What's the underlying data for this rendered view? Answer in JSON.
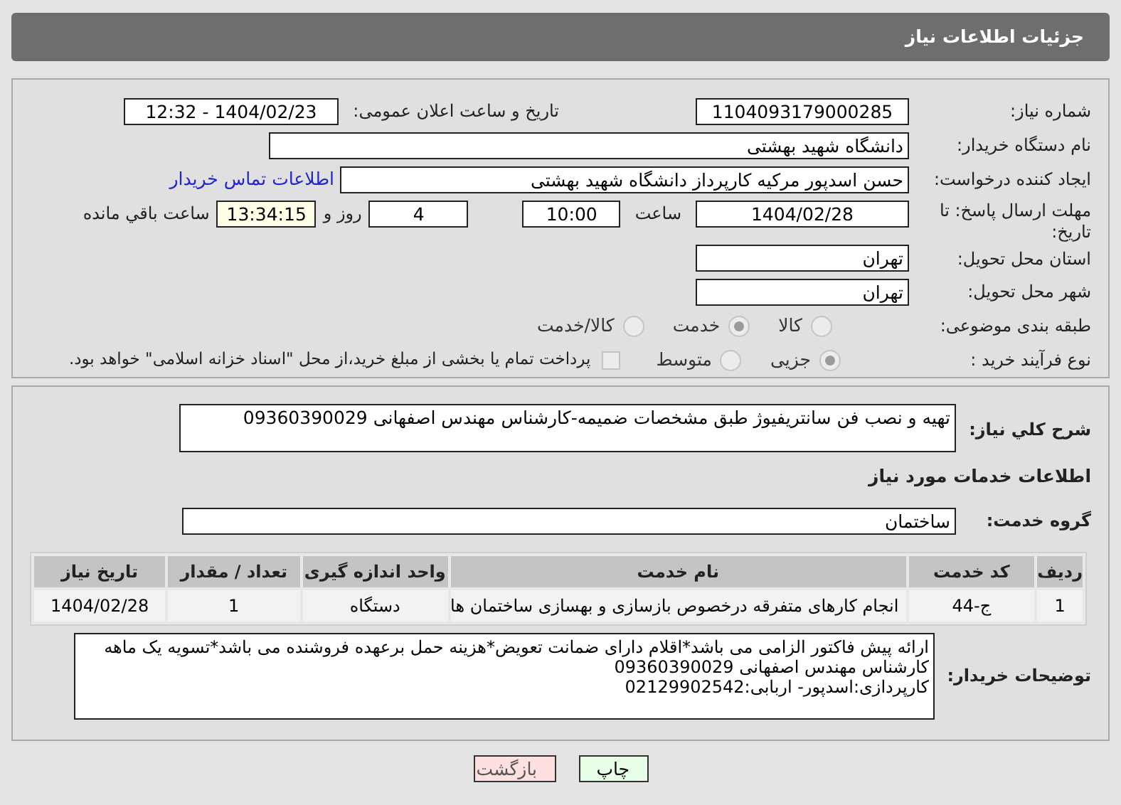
{
  "header": {
    "title": "جزئیات اطلاعات نیاز"
  },
  "details": {
    "need_number": {
      "label": "شماره نیاز:",
      "value": "1104093179000285"
    },
    "announce": {
      "label": "تاریخ و ساعت اعلان عمومی:",
      "value": "1404/02/23 - 12:32"
    },
    "buyer": {
      "label": "نام دستگاه خریدار:",
      "value": "دانشگاه شهید بهشتی"
    },
    "creator": {
      "label": "ایجاد کننده درخواست:",
      "value": "حسن اسدپور مرکیه کارپرداز دانشگاه شهید بهشتی",
      "link": "اطلاعات تماس خریدار"
    },
    "deadline": {
      "label": "مهلت ارسال پاسخ: تا تاریخ:",
      "date": "1404/02/28",
      "time_label": "ساعت",
      "time": "10:00",
      "days": "4",
      "days_label": "روز و",
      "remaining": "13:34:15",
      "remaining_label": "ساعت باقي مانده"
    },
    "province": {
      "label": "استان محل تحویل:",
      "value": "تهران"
    },
    "city": {
      "label": "شهر محل تحویل:",
      "value": "تهران"
    },
    "category": {
      "label": "طبقه بندی موضوعی:",
      "options": [
        {
          "label": "كالا",
          "selected": false
        },
        {
          "label": "خدمت",
          "selected": true
        },
        {
          "label": "كالا/خدمت",
          "selected": false
        }
      ]
    },
    "process": {
      "label": "نوع فرآیند خرید :",
      "options": [
        {
          "label": "جزیی",
          "selected": true
        },
        {
          "label": "متوسط",
          "selected": false
        }
      ],
      "treasury": {
        "checked": false,
        "label": "پرداخت تمام یا بخشی از مبلغ خرید،از محل \"اسناد خزانه اسلامی\" خواهد بود."
      }
    }
  },
  "services": {
    "summary": {
      "label": "شرح كلي نياز:",
      "value": "تهیه و نصب فن سانتریفیوژ طبق مشخصات ضمیمه-کارشناس مهندس اصفهانی 09360390029"
    },
    "heading": "اطلاعات خدمات مورد نياز",
    "group": {
      "label": "گروه خدمت:",
      "value": "ساختمان"
    },
    "table": {
      "columns": [
        "ردیف",
        "کد خدمت",
        "نام خدمت",
        "واحد اندازه گیری",
        "تعداد / مقدار",
        "تاریخ نیاز"
      ],
      "rows": [
        [
          "1",
          "ج-44",
          "انجام کارهای متفرقه درخصوص بازسازی و بهسازی ساختمان ها",
          "دستگاه",
          "1",
          "1404/02/28"
        ]
      ]
    },
    "notes": {
      "label": "توضیحات خریدار:",
      "lines": [
        "ارائه پیش فاکتور الزامی می باشد*اقلام دارای ضمانت تعویض*هزینه حمل برعهده فروشنده می باشد*تسویه یک ماهه",
        "کارشناس مهندس اصفهانی 09360390029",
        "کارپردازی:اسدپور- اربابی:02129902542"
      ]
    }
  },
  "buttons": [
    {
      "label": "چاپ",
      "kind": "print"
    },
    {
      "label": "بازگشت",
      "kind": "back"
    }
  ]
}
